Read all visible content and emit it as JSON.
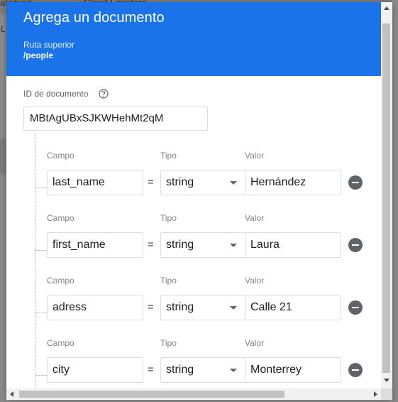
{
  "background": {
    "crumb_left": "atzibiod",
    "crumb_right": "Cloud Firestore",
    "side_letter": "L"
  },
  "dialog": {
    "title": "Agrega un documento",
    "parent_label": "Ruta superior",
    "parent_path": "/people",
    "doc_id_label": "ID de documento",
    "doc_id_value": "MBtAgUBxSJKWHehMt2qM",
    "help_icon": "help-circle-icon",
    "field_header": "Campo",
    "type_header": "Tipo",
    "value_header": "Valor",
    "equals": "=",
    "fields": [
      {
        "name": "last_name",
        "type": "string",
        "value": "Hernández"
      },
      {
        "name": "first_name",
        "type": "string",
        "value": "Laura"
      },
      {
        "name": "adress",
        "type": "string",
        "value": "Calle 21"
      },
      {
        "name": "city",
        "type": "string",
        "value": "Monterrey"
      }
    ]
  },
  "colors": {
    "header_blue": "#1a73e8",
    "remove_icon": "#5f6368"
  }
}
